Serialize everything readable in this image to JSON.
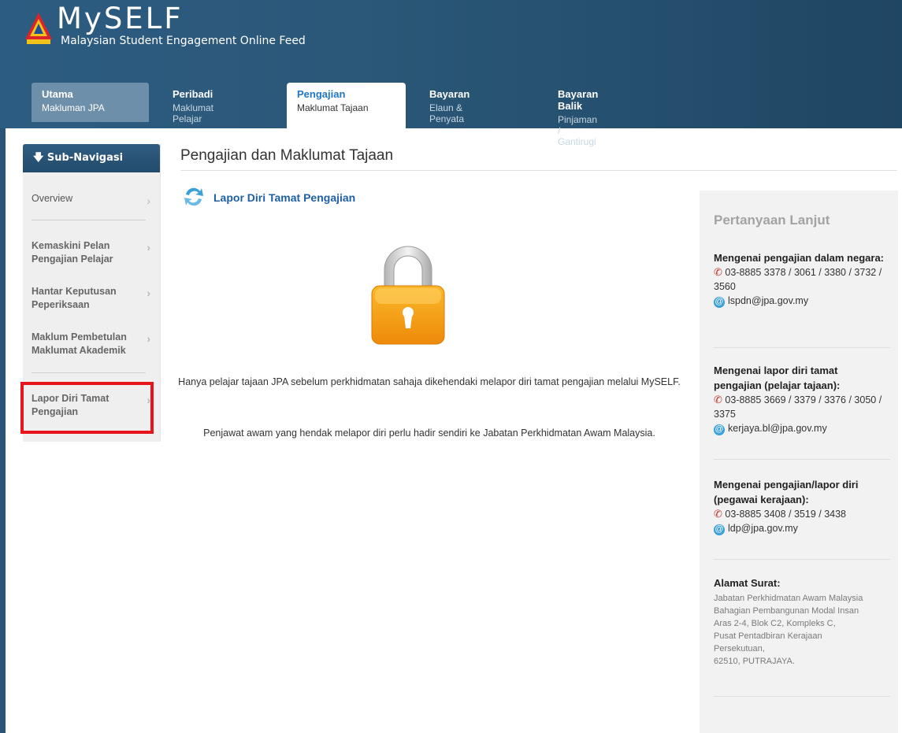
{
  "header": {
    "logo_title": "MySELF",
    "logo_subtitle": "Malaysian Student Engagement Online Feed",
    "tabs": [
      {
        "title": "Utama",
        "subtitle": "Makluman JPA"
      },
      {
        "title": "Peribadi",
        "subtitle": "Maklumat Pelajar"
      },
      {
        "title": "Pengajian",
        "subtitle": "Maklumat Tajaan"
      },
      {
        "title": "Bayaran",
        "subtitle": "Elaun & Penyata"
      },
      {
        "title": "Bayaran Balik",
        "subtitle": "Pinjaman / Gantirugi"
      }
    ],
    "active_tab": "Pengajian"
  },
  "sidebar": {
    "heading": "Sub-Navigasi",
    "heading_icon": "arrow-down-icon",
    "items": [
      {
        "label": "Overview"
      },
      {
        "label": "Kemaskini Pelan Pengajian Pelajar"
      },
      {
        "label": "Hantar Keputusan Peperiksaan"
      },
      {
        "label": "Maklum Pembetulan Maklumat Akademik"
      },
      {
        "label": "Lapor Diri Tamat Pengajian"
      }
    ],
    "highlight_color": "#e8141b"
  },
  "main": {
    "page_title": "Pengajian dan Maklumat Tajaan",
    "section_title": "Lapor Diri Tamat Pengajian",
    "message_1": "Hanya pelajar tajaan JPA sebelum perkhidmatan sahaja dikehendaki melapor diri tamat pengajian melalui MySELF.",
    "message_2": "Penjawat awam yang hendak melapor diri perlu hadir sendiri ke Jabatan Perkhidmatan Awam Malaysia."
  },
  "panel": {
    "title": "Pertanyaan Lanjut",
    "contacts": [
      {
        "heading": "Mengenai pengajian dalam negara:",
        "phone": "03-8885 3378 / 3061 / 3380 / 3732 / 3560",
        "email": "lspdn@jpa.gov.my"
      },
      {
        "heading": "Mengenai lapor diri tamat pengajian (pelajar tajaan):",
        "phone": "03-8885 3669 / 3379 / 3376 / 3050 / 3375",
        "email": "kerjaya.bl@jpa.gov.my"
      },
      {
        "heading": "Mengenai pengajian/lapor diri (pegawai kerajaan):",
        "phone": "03-8885 3408 / 3519 / 3438",
        "email": "ldp@jpa.gov.my"
      }
    ],
    "address_heading": "Alamat Surat:",
    "address_lines": [
      "Jabatan Perkhidmatan Awam Malaysia",
      "Bahagian Pembangunan Modal Insan",
      "Aras 2-4, Blok C2, Kompleks C,",
      "Pusat Pentadbiran Kerajaan",
      "Persekutuan,",
      "62510, PUTRAJAYA."
    ]
  },
  "colors": {
    "header_blue": "#2b5778",
    "link_blue": "#1f5fa6",
    "lock_orange": "#f29a12"
  }
}
